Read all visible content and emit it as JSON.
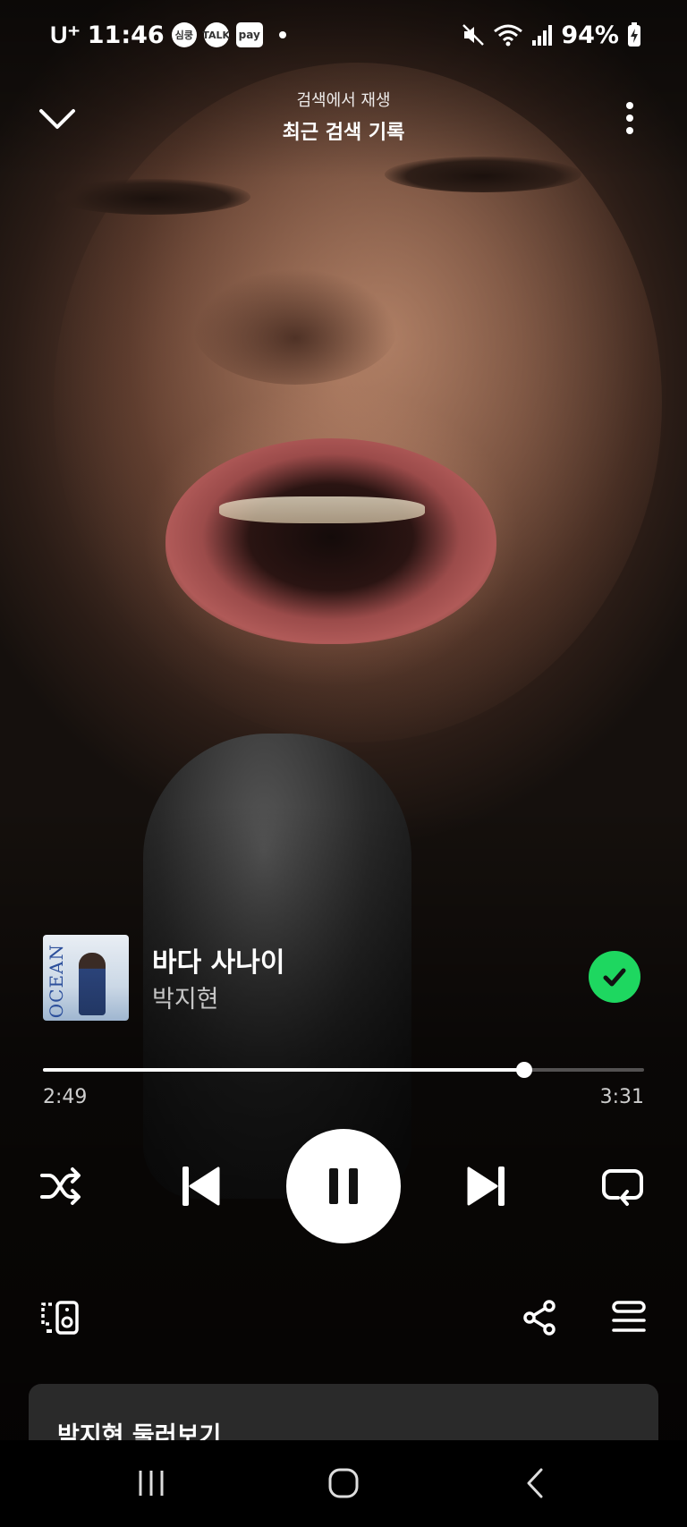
{
  "status_bar": {
    "carrier": "U⁺",
    "time": "11:46",
    "badges": [
      "심쿵",
      "TALK",
      "pay"
    ],
    "battery": "94%",
    "icons": [
      "mute-icon",
      "wifi-icon",
      "signal-icon",
      "battery-charging-icon"
    ]
  },
  "header": {
    "context_label": "검색에서 재생",
    "context_title": "최근 검색 기록"
  },
  "track": {
    "title": "바다 사나이",
    "artist": "박지현",
    "album_art_text": "OCEAN",
    "liked": true
  },
  "playback": {
    "elapsed": "2:49",
    "total": "3:31",
    "progress_fraction": 0.801,
    "is_playing": true
  },
  "controls": [
    "shuffle-icon",
    "previous-icon",
    "pause-icon",
    "next-icon",
    "repeat-icon"
  ],
  "secondary_actions": [
    "devices-icon",
    "share-icon",
    "queue-icon"
  ],
  "explore_card": {
    "title": "박지현 둘러보기"
  },
  "colors": {
    "accent": "#1ed760",
    "card": "#2a2a2a"
  }
}
